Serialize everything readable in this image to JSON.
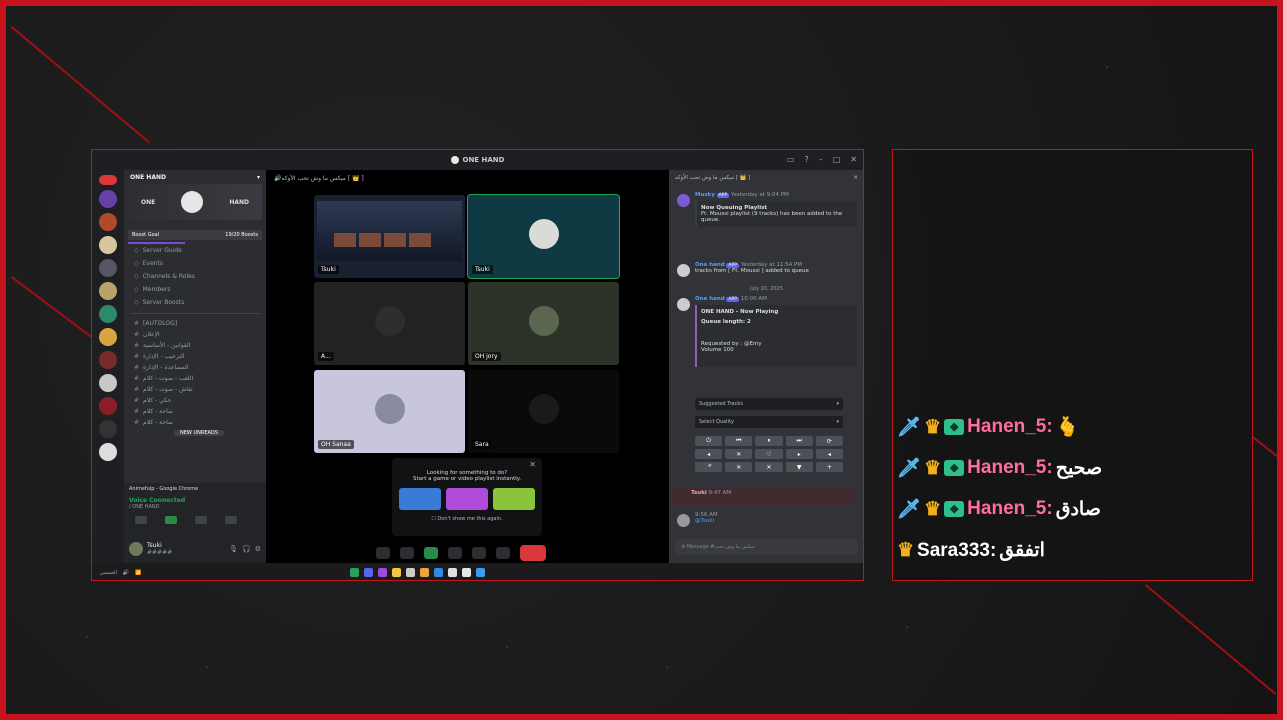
{
  "window": {
    "title": "ONE HAND",
    "controls": [
      "minimize-icon",
      "help-icon",
      "window-minimize",
      "window-maximize",
      "window-close"
    ]
  },
  "server": {
    "name": "ONE HAND",
    "banner_left": "ONE",
    "banner_right": "HAND",
    "boost_label": "Boost Goal",
    "boost_value": "19/20 Boosts",
    "nav": [
      "Server Guide",
      "Events",
      "Channels & Roles",
      "Members",
      "Server Boosts"
    ],
    "channels": [
      "[AUTOLOG]",
      "الإعلان",
      "القوانين - الأساسية",
      "الترحيب - الإدارة",
      "المساعدة - الإدارة",
      "اللعب - صوت - كلام",
      "نقاش - صوت - كلام",
      "حكي - كلام",
      "ساحة - كلام",
      "ساحة - كلام"
    ],
    "new_unreads": "NEW UNREADS"
  },
  "activity": {
    "title": "Animefuip - Google Chrome",
    "voice_connected": "Voice Connected",
    "voice_channel": "/ ONE HAND"
  },
  "user": {
    "name": "Tsuki",
    "status": "#####"
  },
  "stage": {
    "channel_title": "ميكس ما وش تحب الأوكه [ 👑 ]",
    "tiles": [
      {
        "label": "Tsuki"
      },
      {
        "label": "Tsuki"
      },
      {
        "label": "A..."
      },
      {
        "label": "OH jory"
      },
      {
        "label": "OH Sanaa"
      },
      {
        "label": "Sara"
      }
    ],
    "suggest_title": "Looking for something to do?",
    "suggest_sub": "Start a game or video playlist instantly.",
    "dont_show": "Don't show me this again."
  },
  "chat": {
    "header": "ميكس ما وش تحب الأوكه [ 👑 ]",
    "m1_name": "Musky",
    "m1_tag": "APP",
    "m1_time": "Yesterday at 9:04 PM",
    "m1_title": "Now Queuing Playlist",
    "m1_text": "Ft. Moussi playlist (9 tracks) has been added to the queue.",
    "m2_name": "One hand",
    "m2_tag": "APP",
    "m2_time": "Yesterday at 11:54 PM",
    "m2_text": "tracks from [ Ft. Moussi ] added to queue",
    "date_divider": "July 20, 2025",
    "m3_name": "One hand",
    "m3_tag": "APP",
    "m3_time": "10:00 AM",
    "m3_title": "ONE HAND - Now Playing",
    "m3_queue": "Queue length: 2",
    "m3_requested": "Requested by : @Emy",
    "m3_volume": "Volume 100",
    "suggested_tracks": "Suggested Tracks",
    "select_quality": "Select Quality",
    "controls": [
      "⏻",
      "⏮",
      "⏸",
      "⏭",
      "⟳",
      "◂",
      "✕",
      "♡",
      "▸",
      "◂",
      "🎤",
      "✕",
      "✕",
      "▼",
      "+"
    ],
    "m4_name": "Tsuki",
    "m4_time": "9:47 AM",
    "m5_name": "@Tsuki",
    "m5_time": "9:56 AM",
    "input_placeholder": "Message #ميكس ما وش تحب"
  },
  "overlay": {
    "lines": [
      {
        "user": "Hanen_5:",
        "text": "🫰"
      },
      {
        "user": "Hanen_5:",
        "text": "صحيح"
      },
      {
        "user": "Hanen_5:",
        "text": "صادق"
      },
      {
        "user": "Sara333:",
        "text": "اتفقق"
      }
    ],
    "colors": {
      "pink": "#ff6f9a",
      "white": "#ffffff",
      "crown": "#f2b01e",
      "sword": "#5ab8f0"
    }
  },
  "taskbar": {
    "left_text": "الخميس",
    "search": "بحث"
  }
}
